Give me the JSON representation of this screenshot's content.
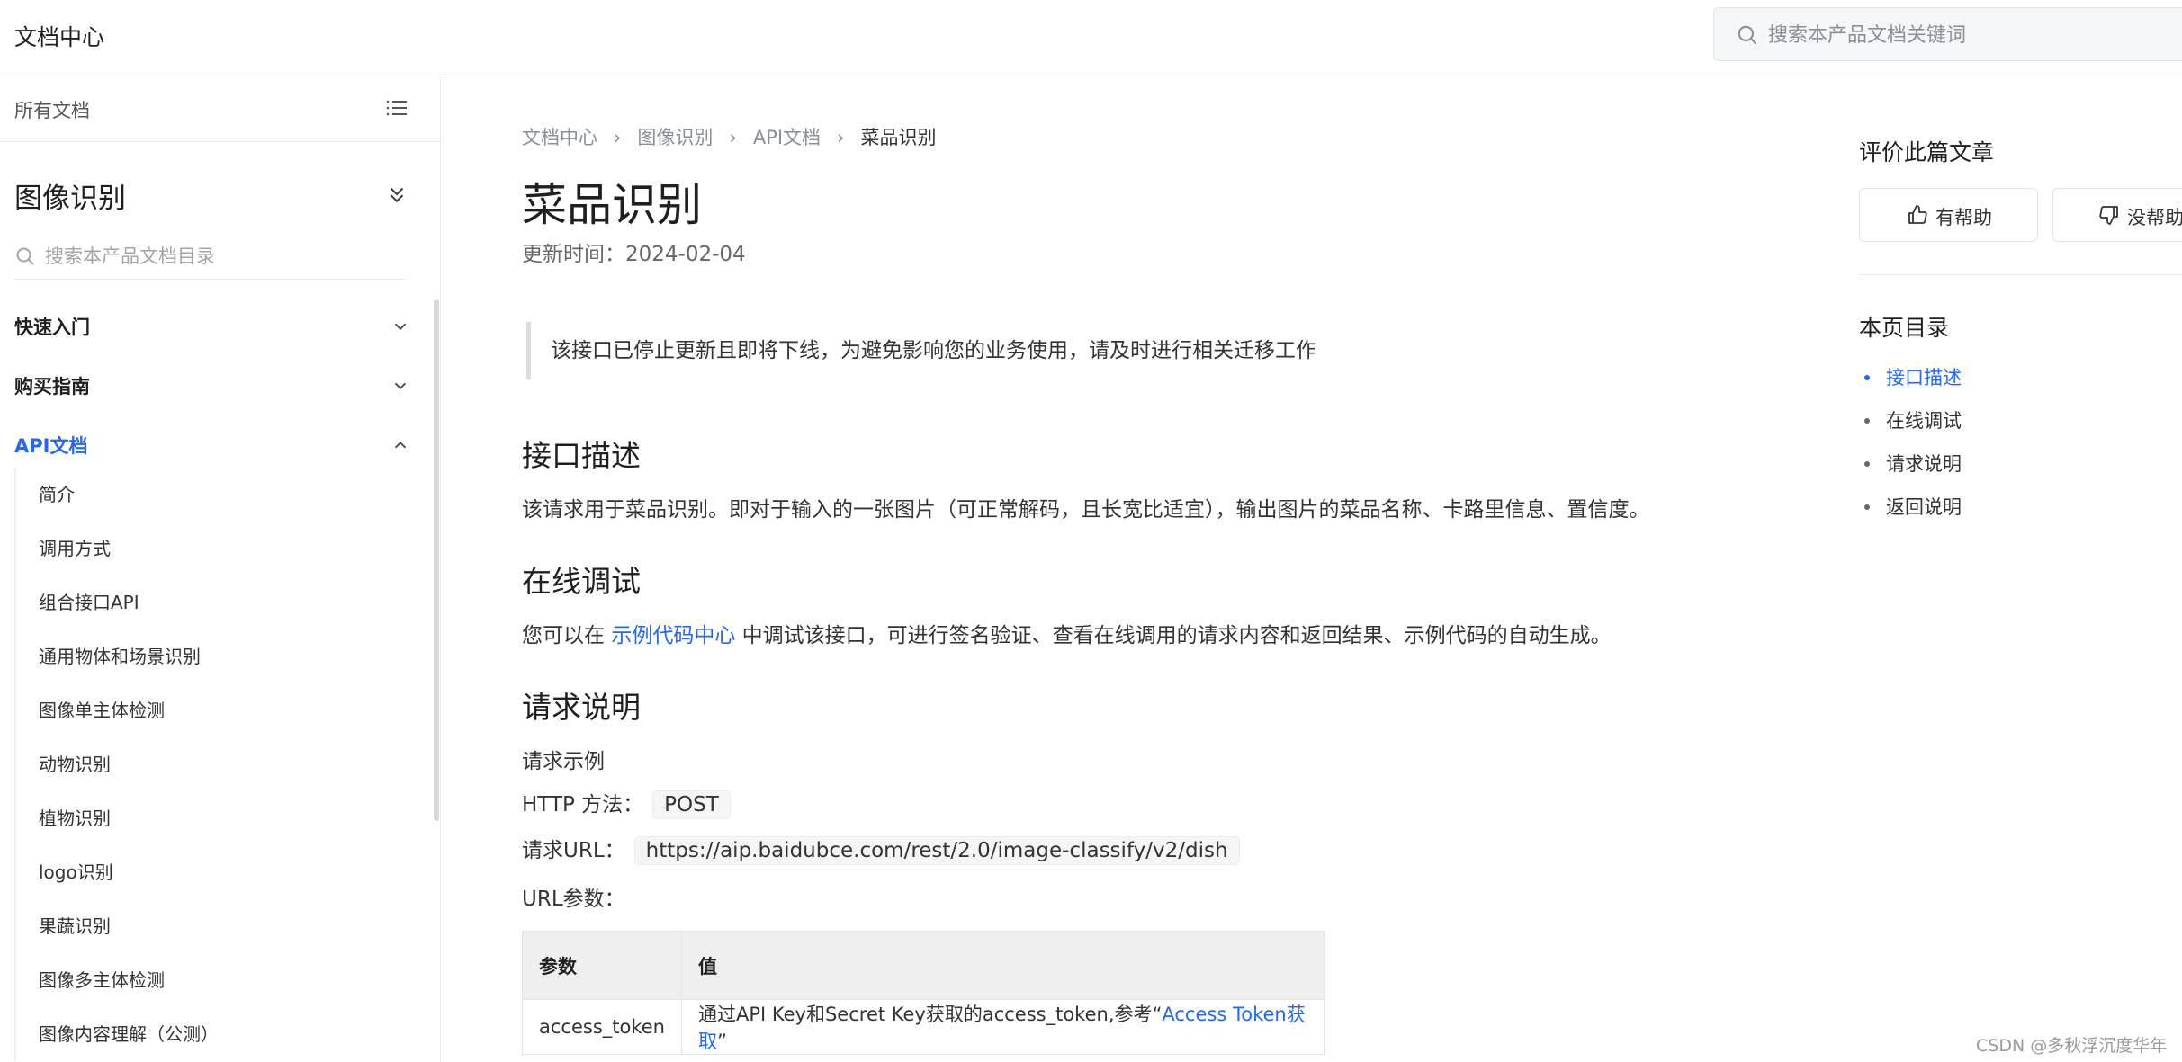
{
  "header": {
    "site_title": "文档中心",
    "search_placeholder": "搜索本产品文档关键词"
  },
  "sidebar": {
    "all_docs": "所有文档",
    "product_title": "图像识别",
    "dir_search_placeholder": "搜索本产品文档目录",
    "sections": [
      {
        "label": "快速入门",
        "expanded": false
      },
      {
        "label": "购买指南",
        "expanded": false
      },
      {
        "label": "API文档",
        "expanded": true
      }
    ],
    "sub_items": [
      "简介",
      "调用方式",
      "组合接口API",
      "通用物体和场景识别",
      "图像单主体检测",
      "动物识别",
      "植物识别",
      "logo识别",
      "果蔬识别",
      "图像多主体检测",
      "图像内容理解（公测）"
    ]
  },
  "main": {
    "breadcrumb": [
      "文档中心",
      "图像识别",
      "API文档",
      "菜品识别"
    ],
    "title": "菜品识别",
    "updated": "更新时间：2024-02-04",
    "notice": "该接口已停止更新且即将下线，为避免影响您的业务使用，请及时进行相关迁移工作",
    "sections": {
      "desc_title": "接口描述",
      "desc_text": "该请求用于菜品识别。即对于输入的一张图片（可正常解码，且长宽比适宜），输出图片的菜品名称、卡路里信息、置信度。",
      "debug_title": "在线调试",
      "debug_prefix": "您可以在 ",
      "debug_link": "示例代码中心",
      "debug_suffix": " 中调试该接口，可进行签名验证、查看在线调用的请求内容和返回结果、示例代码的自动生成。",
      "request_title": "请求说明",
      "request_example": "请求示例",
      "http_method_label": "HTTP 方法：",
      "http_method": "POST",
      "url_label": "请求URL：",
      "url": "https://aip.baidubce.com/rest/2.0/image-classify/v2/dish",
      "url_params_label": "URL参数："
    },
    "table": {
      "headers": [
        "参数",
        "值"
      ],
      "rows": [
        {
          "param": "access_token",
          "value_prefix": "通过API Key和Secret Key获取的access_token,参考“",
          "value_link": "Access Token获取",
          "value_suffix": "”"
        }
      ]
    }
  },
  "right": {
    "rate_title": "评价此篇文章",
    "helpful": "有帮助",
    "not_helpful": "没帮助",
    "toc_title": "本页目录",
    "toc": [
      "接口描述",
      "在线调试",
      "请求说明",
      "返回说明"
    ]
  },
  "watermark": "CSDN @多秋浮沉度华年",
  "colors": {
    "accent": "#2468f2",
    "text": "#1f1f1f",
    "muted": "#8a8f99"
  }
}
